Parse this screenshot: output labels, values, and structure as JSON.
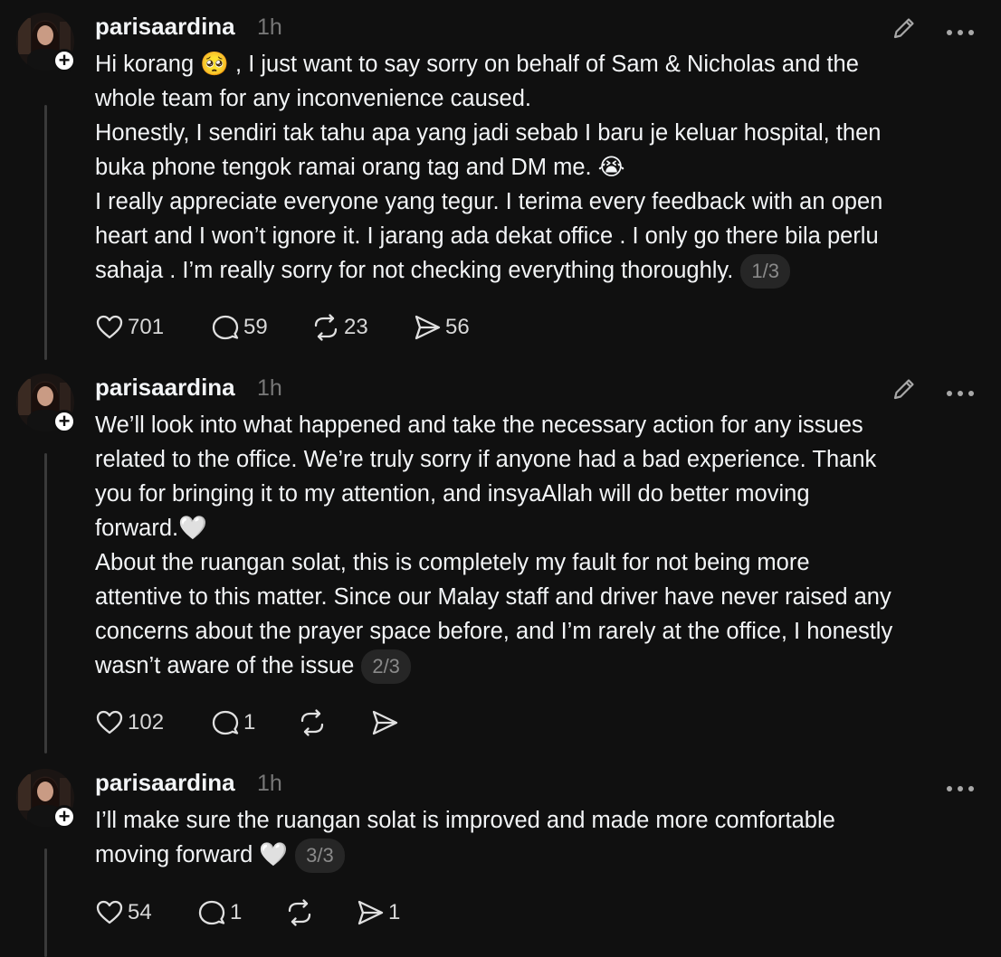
{
  "posts": [
    {
      "username": "parisaardina",
      "time": "1h",
      "text": "Hi korang 🥺 , I just want to say sorry on behalf of Sam & Nicholas and the\nwhole team for any inconvenience caused.\nHonestly, I sendiri tak tahu apa yang jadi sebab I baru je keluar hospital, then\nbuka phone tengok ramai orang tag and DM me. 😭\nI really appreciate everyone yang tegur. I terima every feedback with an open\nheart and I won’t ignore it. I jarang ada dekat office . I only go there bila perlu\nsahaja . I’m really sorry for not checking everything thoroughly.",
      "page": "1/3",
      "likes": "701",
      "replies": "59",
      "reposts": "23",
      "shares": "56"
    },
    {
      "username": "parisaardina",
      "time": "1h",
      "text": "We’ll look into what happened and take the necessary action for any issues\nrelated to the office. We’re truly sorry if anyone had a bad experience. Thank\nyou for bringing it to my attention, and insyaAllah will do better moving\nforward.🤍\nAbout the ruangan solat, this is completely my fault for not being more\nattentive to this matter. Since our Malay staff and driver have never raised any\nconcerns about the prayer space before, and I’m rarely at the office, I honestly\nwasn’t aware of the issue",
      "page": "2/3",
      "likes": "102",
      "replies": "1",
      "reposts": "",
      "shares": ""
    },
    {
      "username": "parisaardina",
      "time": "1h",
      "text": "I’ll make sure the ruangan solat is improved and made more comfortable\nmoving forward 🤍",
      "page": "3/3",
      "likes": "54",
      "replies": "1",
      "reposts": "",
      "shares": "1"
    }
  ],
  "icons": {
    "like": "heart-icon",
    "reply": "comment-icon",
    "repost": "repost-icon",
    "share": "send-icon",
    "edit": "pencil-icon",
    "more": "more-icon",
    "follow": "plus-icon"
  },
  "colors": {
    "background": "#101010",
    "text": "#f3f5f7",
    "muted": "#777777"
  }
}
